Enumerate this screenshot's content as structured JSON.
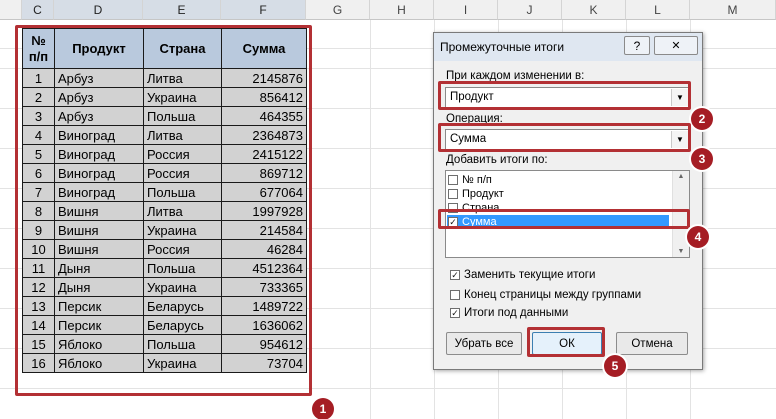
{
  "columns": [
    "C",
    "D",
    "E",
    "F",
    "G",
    "H",
    "I",
    "J",
    "K",
    "L",
    "M"
  ],
  "table": {
    "headers": [
      "№ п/п",
      "Продукт",
      "Страна",
      "Сумма"
    ],
    "rows": [
      [
        "1",
        "Арбуз",
        "Литва",
        "2145876"
      ],
      [
        "2",
        "Арбуз",
        "Украина",
        "856412"
      ],
      [
        "3",
        "Арбуз",
        "Польша",
        "464355"
      ],
      [
        "4",
        "Виноград",
        "Литва",
        "2364873"
      ],
      [
        "5",
        "Виноград",
        "Россия",
        "2415122"
      ],
      [
        "6",
        "Виноград",
        "Россия",
        "869712"
      ],
      [
        "7",
        "Виноград",
        "Польша",
        "677064"
      ],
      [
        "8",
        "Вишня",
        "Литва",
        "1997928"
      ],
      [
        "9",
        "Вишня",
        "Украина",
        "214584"
      ],
      [
        "10",
        "Вишня",
        "Россия",
        "46284"
      ],
      [
        "11",
        "Дыня",
        "Польша",
        "4512364"
      ],
      [
        "12",
        "Дыня",
        "Украина",
        "733365"
      ],
      [
        "13",
        "Персик",
        "Беларусь",
        "1489722"
      ],
      [
        "14",
        "Персик",
        "Беларусь",
        "1636062"
      ],
      [
        "15",
        "Яблоко",
        "Польша",
        "954612"
      ],
      [
        "16",
        "Яблоко",
        "Украина",
        "73704"
      ]
    ]
  },
  "dialog": {
    "title": "Промежуточные итоги",
    "help": "?",
    "close": "✕",
    "group_by_label": "При каждом изменении в:",
    "group_by_value": "Продукт",
    "function_label": "Операция:",
    "function_value": "Сумма",
    "add_to_label": "Добавить итоги по:",
    "fields": [
      {
        "label": "№ п/п",
        "checked": false
      },
      {
        "label": "Продукт",
        "checked": false
      },
      {
        "label": "Страна",
        "checked": false
      },
      {
        "label": "Сумма",
        "checked": true
      }
    ],
    "options": [
      {
        "label": "Заменить текущие итоги",
        "checked": true
      },
      {
        "label": "Конец страницы между группами",
        "checked": false
      },
      {
        "label": "Итоги под данными",
        "checked": true
      }
    ],
    "remove_all": "Убрать все",
    "ok": "ОК",
    "cancel": "Отмена"
  },
  "badges": [
    "1",
    "2",
    "3",
    "4",
    "5"
  ],
  "colors": {
    "annotation": "#b33034",
    "header_fill": "#b9c9dd",
    "cell_fill": "#d2d2d2",
    "selection": "#3399ff"
  }
}
